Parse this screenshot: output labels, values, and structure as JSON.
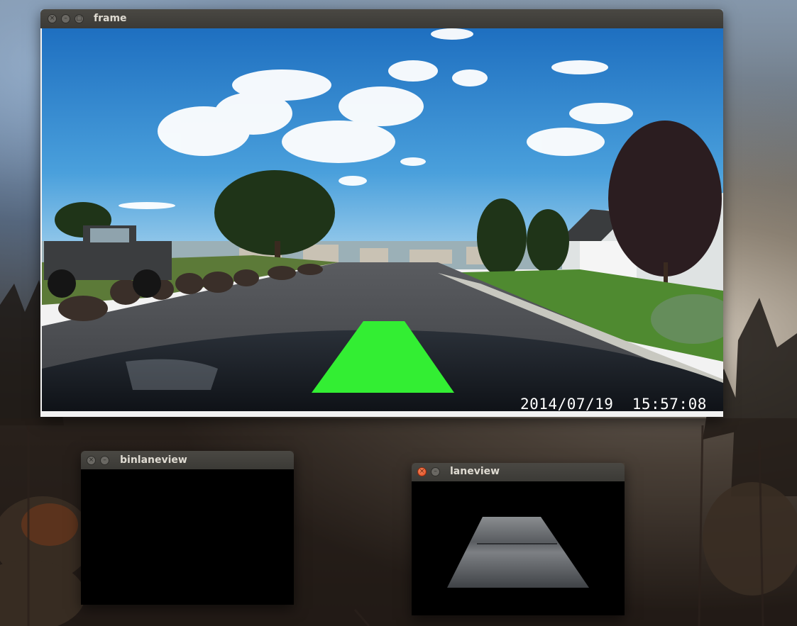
{
  "desktop": {
    "wallpaper": "misty-forest"
  },
  "windows": {
    "frame": {
      "title": "frame",
      "timestamp": "2014/07/19  15:57:08",
      "overlay_color": "#33ee33"
    },
    "binlaneview": {
      "title": "binlaneview"
    },
    "laneview": {
      "title": "laneview"
    }
  },
  "icons": {
    "close": "close-icon",
    "minimize": "minimize-icon",
    "maximize": "maximize-icon"
  }
}
